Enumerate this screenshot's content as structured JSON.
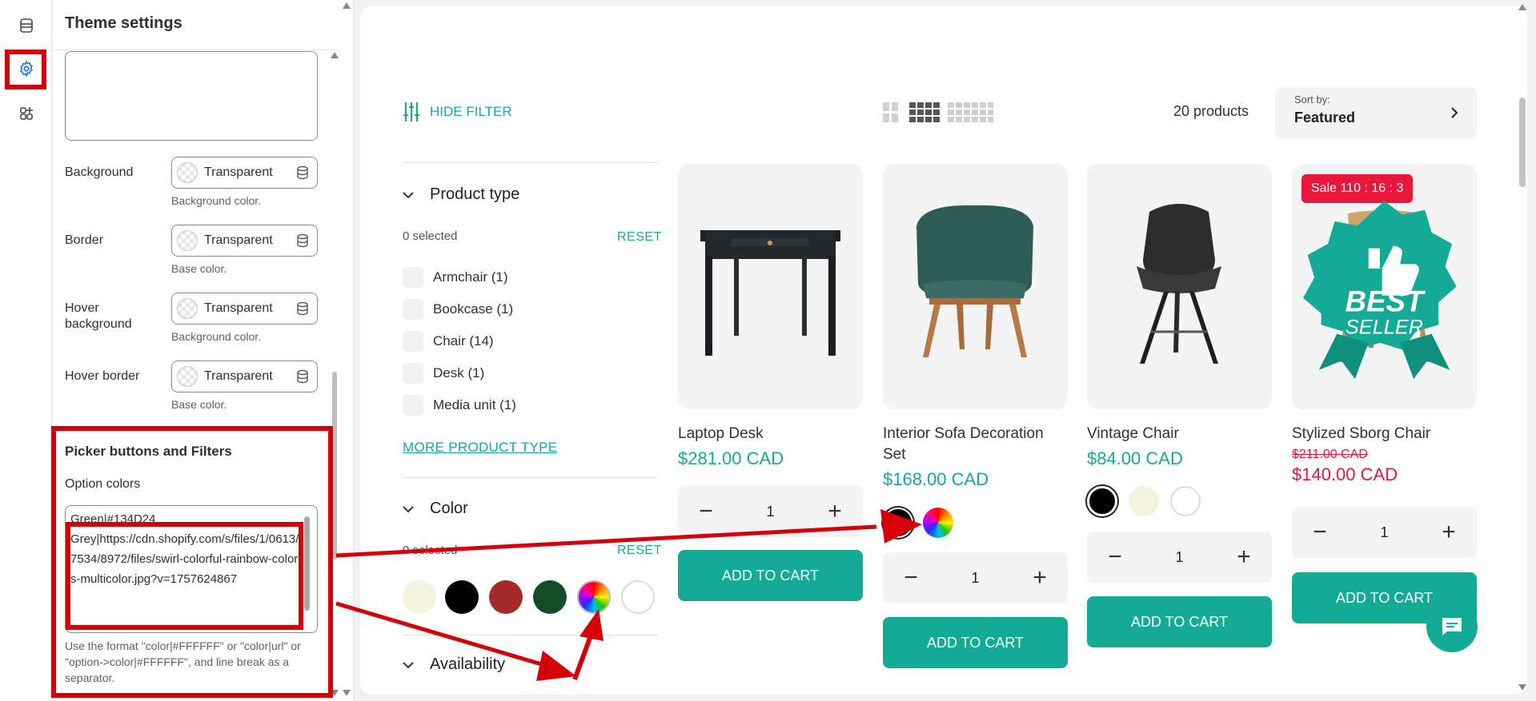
{
  "panel": {
    "title": "Theme settings",
    "rows": [
      {
        "label": "Background",
        "value": "Transparent",
        "help": "Background color."
      },
      {
        "label": "Border",
        "value": "Transparent",
        "help": "Base color."
      },
      {
        "label": "Hover\nbackground",
        "value": "Transparent",
        "help": "Background color."
      },
      {
        "label": "Hover border",
        "value": "Transparent",
        "help": "Base color."
      }
    ],
    "section_heading": "Picker buttons and Filters",
    "option_colors_label": "Option colors",
    "option_colors_value": "Green|#134D24\nGrey|https://cdn.shopify.com/s/files/1/0613/7534/8972/files/swirl-colorful-rainbow-colors-multicolor.jpg?v=1757624867",
    "format_help": "Use the format \"color|#FFFFFF\" or \"color|url\" or \"option->color|#FFFFFF\", and line break as a separator."
  },
  "toolbar": {
    "hide_filter": "HIDE FILTER",
    "product_count": "20 products",
    "sort_label": "Sort by:",
    "sort_value": "Featured"
  },
  "filters": {
    "product_type": {
      "heading": "Product type",
      "selected": "0 selected",
      "reset": "RESET",
      "items": [
        "Armchair (1)",
        "Bookcase (1)",
        "Chair (14)",
        "Desk (1)",
        "Media unit (1)"
      ],
      "more": "MORE PRODUCT TYPE"
    },
    "color": {
      "heading": "Color",
      "selected": "0 selected",
      "reset": "RESET",
      "swatches": [
        "#f4f3dd",
        "#000000",
        "#a52a2a",
        "#134d24",
        "rainbow",
        "#ffffff"
      ]
    },
    "availability": {
      "heading": "Availability"
    }
  },
  "products": [
    {
      "title": "Laptop Desk",
      "price": "$281.00 CAD",
      "qty": "1",
      "add_to_cart": "ADD TO CART"
    },
    {
      "title": "Interior Sofa Decoration Set",
      "price": "$168.00 CAD",
      "qty": "1",
      "add_to_cart": "ADD TO CART"
    },
    {
      "title": "Vintage Chair",
      "price": "$84.00 CAD",
      "qty": "1",
      "add_to_cart": "ADD TO CART"
    },
    {
      "title": "Stylized Sborg Chair",
      "old_price": "$211.00 CAD",
      "price": "$140.00 CAD",
      "qty": "1",
      "add_to_cart": "ADD TO CART",
      "sale_badge": "Sale   110 : 16 : 3",
      "best_seller_line1": "BEST",
      "best_seller_line2": "SELLER"
    }
  ],
  "colors": {
    "accent": "#13ab96",
    "sale": "#e8173b",
    "highlight": "#d6000b"
  }
}
